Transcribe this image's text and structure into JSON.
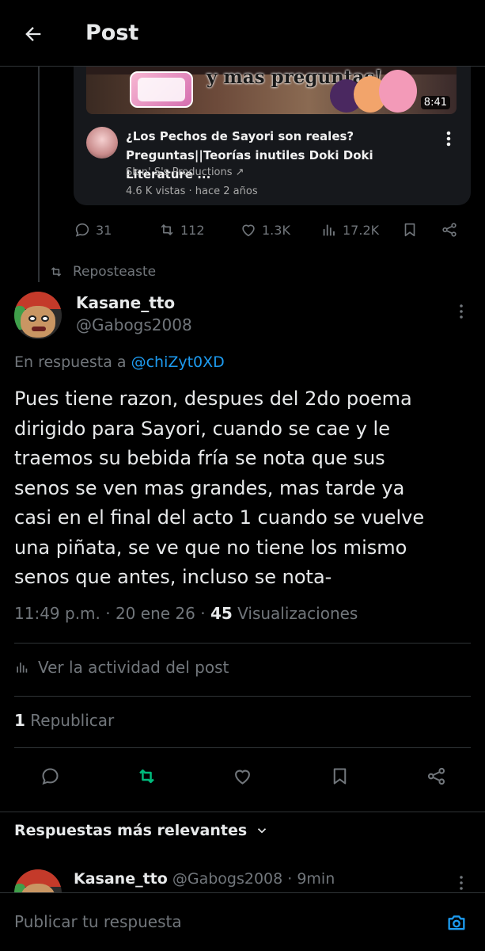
{
  "header": {
    "title": "Post"
  },
  "quoted_video": {
    "thumbnail_text": "y mas preguntas!",
    "duration": "8:41",
    "title": "¿Los Pechos de Sayori son reales?\nPreguntas||Teorías inutiles Doki Doki Literature ...",
    "channel": "Sk n' S's Productions ↗",
    "stats": "4.6 K vistas · hace 2 años"
  },
  "parent_actions": {
    "replies": "31",
    "reposts": "112",
    "likes": "1.3K",
    "views": "17.2K"
  },
  "repost_note": "Reposteaste",
  "post": {
    "display_name": "Kasane_tto",
    "handle": "@Gabogs2008",
    "reply_prefix": "En respuesta a ",
    "reply_mention": "@chiZyt0XD",
    "text": "Pues tiene razon, despues del 2do poema\ndirigido para Sayori, cuando se cae y le\ntraemos su bebida fría se nota que sus\nsenos se ven mas grandes, mas tarde ya\ncasi en el final del acto 1 cuando se vuelve\nuna piñata, se ve que no tiene los mismo\nsenos que antes, incluso se nota-",
    "time": "11:49 p.m. · 20 ene 26 · ",
    "views_count": "45",
    "views_label": " Visualizaciones",
    "activity_label": "Ver la actividad del post",
    "reposts_count": "1",
    "reposts_label": " Republicar"
  },
  "replies_section": {
    "title": "Respuestas más relevantes",
    "first_reply": {
      "name": "Kasane_tto",
      "meta": " @Gabogs2008 · 9min"
    }
  },
  "composer": {
    "placeholder": "Publicar tu respuesta"
  },
  "colors": {
    "background": "#000000",
    "text": "#e7e9ea",
    "muted": "#71767b",
    "accent": "#1d9bf0",
    "repost_active": "#00ba7c"
  }
}
